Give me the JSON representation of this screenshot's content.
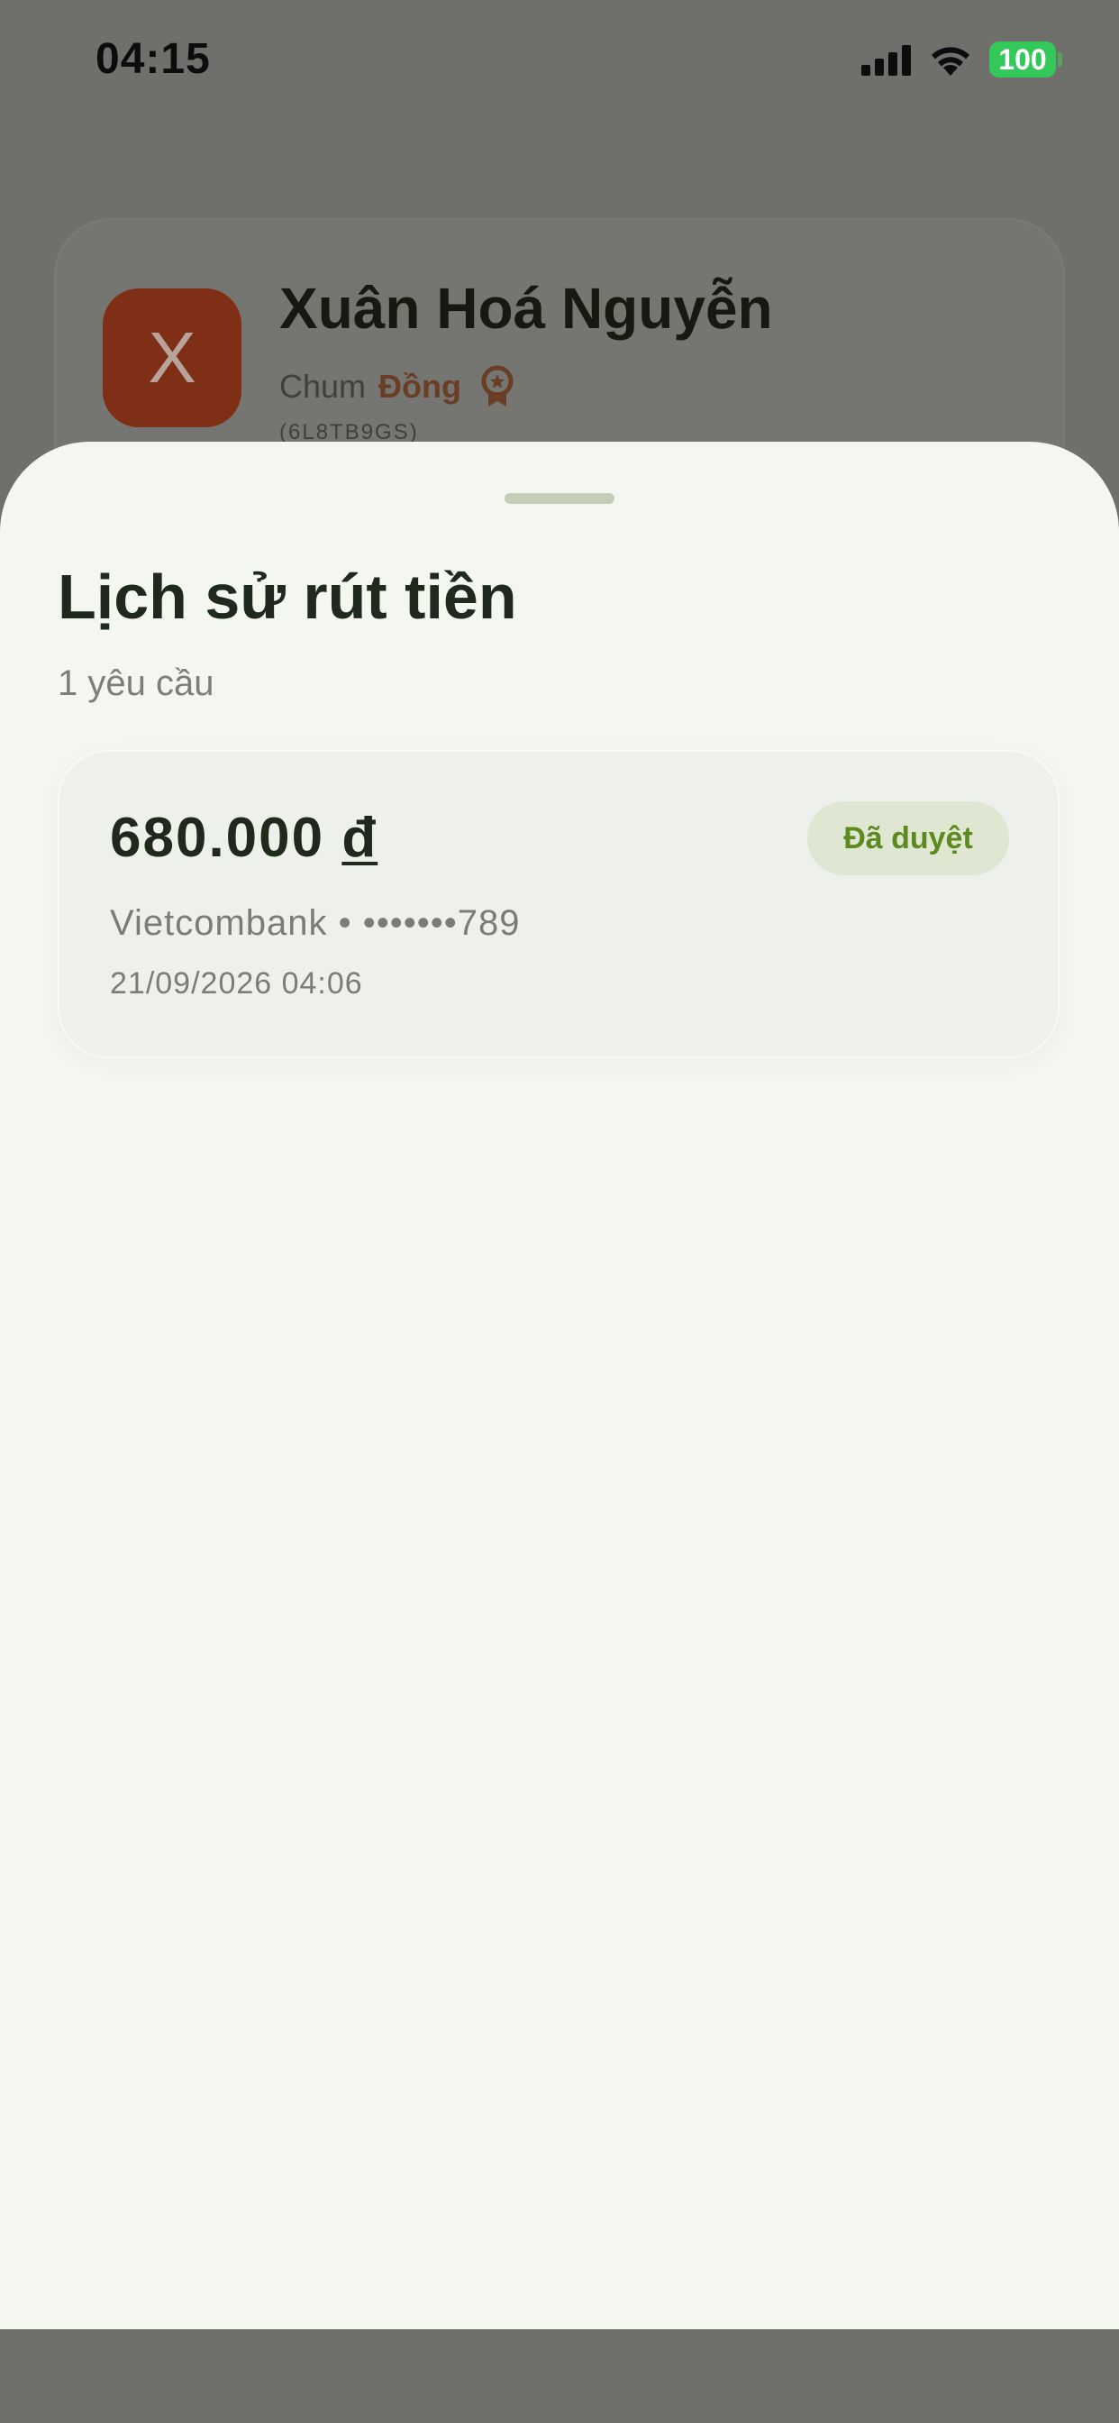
{
  "status_bar": {
    "time": "04:15",
    "battery": "100",
    "icons": [
      "signal-icon",
      "wifi-icon",
      "battery-icon"
    ]
  },
  "profile": {
    "avatar_letter": "X",
    "name": "Xuân Hoá Nguyễn",
    "tier_prefix": "Chum",
    "tier_name": "Đồng",
    "code": "(6L8TB9GS)",
    "icons": [
      "medal-icon"
    ]
  },
  "sheet": {
    "title": "Lịch sử rút tiền",
    "subtitle": "1 yêu cầu",
    "requests": [
      {
        "amount": "680.000",
        "currency": "đ",
        "status": "Đã duyệt",
        "bank_line": "Vietcombank • •••••••789",
        "datetime": "21/09/2026 04:06"
      }
    ]
  },
  "colors": {
    "backdrop": "#6f706b",
    "sheet": "#f4f7f0",
    "title_text": "#1f2a1d",
    "muted_text": "#7c7f78",
    "badge_bg": "#dfe6d1",
    "badge_text": "#5d8a1f",
    "battery": "#34c759",
    "avatar": "#7f2f16",
    "tier": "#6a3d26"
  }
}
